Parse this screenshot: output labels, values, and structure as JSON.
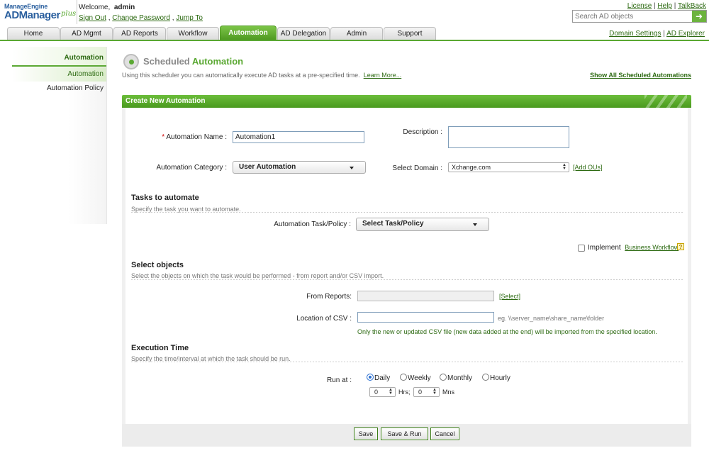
{
  "header": {
    "logo_top": "ManageEngine",
    "logo_main": "ADManager",
    "logo_plus": "plus",
    "welcome_prefix": "Welcome,",
    "username": "admin",
    "links": [
      "Sign Out",
      "Change Password",
      "Jump To"
    ],
    "top_links": [
      "License",
      "Help",
      "TalkBack"
    ],
    "search_placeholder": "Search AD objects",
    "search_go_icon": "arrow-right-icon"
  },
  "tabs": [
    {
      "label": "Home"
    },
    {
      "label": "AD Mgmt"
    },
    {
      "label": "AD Reports"
    },
    {
      "label": "Workflow"
    },
    {
      "label": "Automation",
      "active": true
    },
    {
      "label": "AD Delegation"
    },
    {
      "label": "Admin"
    },
    {
      "label": "Support"
    }
  ],
  "tab_right_links": [
    "Domain Settings",
    "AD Explorer"
  ],
  "sidebar": {
    "heading": "Automation",
    "items": [
      {
        "label": "Automation",
        "selected": true
      },
      {
        "label": "Automation Policy"
      }
    ]
  },
  "page": {
    "title_gray": "Scheduled",
    "title_green": "Automation",
    "description": "Using this scheduler you can automatically execute AD tasks at a pre-specified time.",
    "learn_more": "Learn More...",
    "show_all": "Show All Scheduled Automations"
  },
  "panel": {
    "heading": "Create New Automation"
  },
  "form": {
    "name_label": "Automation Name :",
    "name_value": "Automation1",
    "description_label": "Description :",
    "description_value": "",
    "category_label": "Automation Category :",
    "category_value": "User Automation",
    "domain_label": "Select Domain :",
    "domain_value": "Xchange.com",
    "add_ous": "[Add OUs]"
  },
  "tasks": {
    "title": "Tasks to automate",
    "subtitle": "Specify the task you want to automate.",
    "task_label": "Automation Task/Policy :",
    "task_value": "Select Task/Policy",
    "implement_label": "Implement",
    "business_workflow": "Business Workflow",
    "help_icon": "?"
  },
  "objects": {
    "title": "Select objects",
    "subtitle": "Select the objects on which the task would be performed - from report and/or CSV import.",
    "from_reports_label": "From Reports:",
    "from_reports_value": "",
    "select_link": "[Select]",
    "csv_label": "Location of CSV :",
    "csv_value": "",
    "csv_hint": "eg. \\\\server_name\\share_name\\folder",
    "csv_note": "Only the new or updated CSV file (new data added at the end) will be imported from the specified location."
  },
  "execution": {
    "title": "Execution Time",
    "subtitle": "Specify the time/interval at which the task should be run.",
    "run_at_label": "Run at :",
    "options": [
      "Daily",
      "Weekly",
      "Monthly",
      "Hourly"
    ],
    "selected_option": "Daily",
    "hours_value": "0",
    "hours_label": "Hrs;",
    "mins_value": "0",
    "mins_label": "Mns"
  },
  "buttons": {
    "save": "Save",
    "save_run": "Save & Run",
    "cancel": "Cancel"
  },
  "colors": {
    "accent_green": "#5aa832",
    "link_green": "#2d6a12",
    "logo_blue": "#2a5f9e",
    "required_red": "#cc0000"
  }
}
